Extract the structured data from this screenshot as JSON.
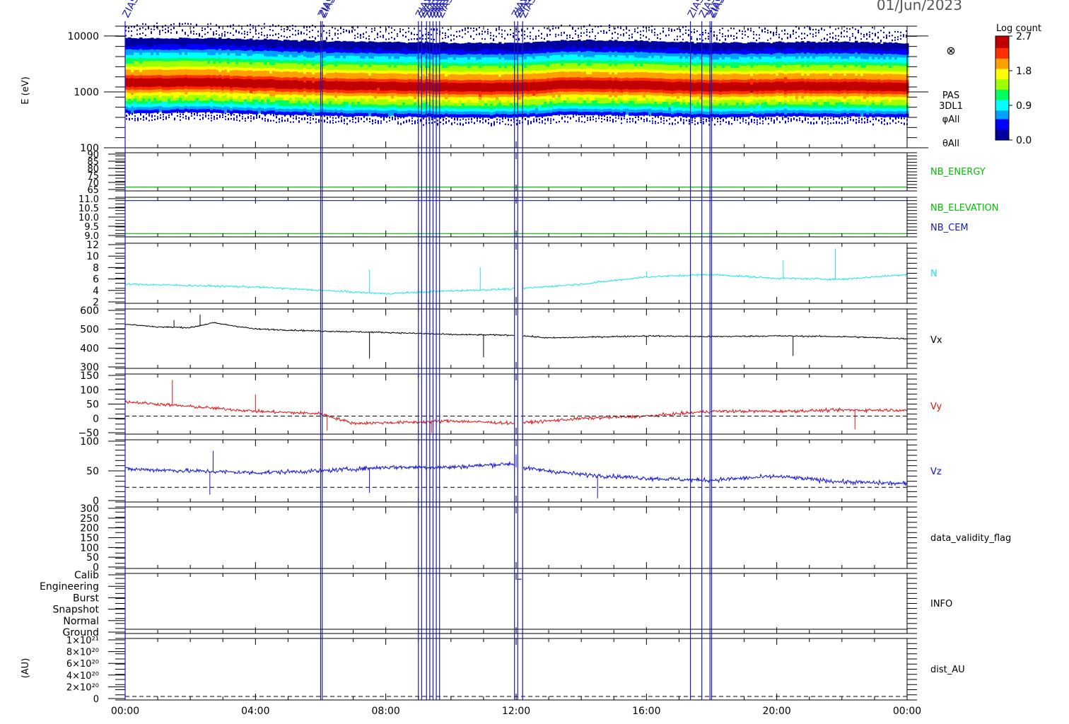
{
  "header": {
    "date": "01/Jun/2023",
    "event_label": "ZIAS"
  },
  "x_axis": {
    "tick_labels": [
      "00:00",
      "04:00",
      "08:00",
      "12:00",
      "16:00",
      "20:00",
      "00:00"
    ],
    "range_hours": [
      0,
      24
    ]
  },
  "colorbar": {
    "title": "Log count",
    "ticks": [
      "2.7",
      "1.8",
      "0.9",
      "0.0"
    ],
    "range": [
      0.0,
      2.7
    ],
    "colors": [
      "#0000a0",
      "#0000ff",
      "#00a0ff",
      "#00ffff",
      "#00ff60",
      "#a0ff00",
      "#ffff00",
      "#ffa000",
      "#ff3000",
      "#c00000"
    ]
  },
  "panels": {
    "spectrogram": {
      "ylabel": "E (eV)",
      "yticks": [
        "10000",
        "1000",
        "100"
      ],
      "side_labels": [
        "PAS",
        "3DL1",
        "φAll",
        "θAll"
      ],
      "marker_symbol": "⊗"
    },
    "nb_energy": {
      "label": "NB_ENERGY",
      "yticks": [
        "90",
        "85",
        "80",
        "75",
        "70",
        "65"
      ]
    },
    "nb_elev": {
      "label1": "NB_ELEVATION",
      "label2": "NB_CEM",
      "yticks": [
        "11.0",
        "10.5",
        "10.0",
        "9.5",
        "9.0"
      ]
    },
    "n": {
      "label": "N",
      "yticks": [
        "12",
        "10",
        "8",
        "6",
        "4",
        "2"
      ]
    },
    "vx": {
      "label": "Vx",
      "yticks": [
        "600",
        "500",
        "400",
        "300"
      ]
    },
    "vy": {
      "label": "Vy",
      "yticks": [
        "150",
        "100",
        "50",
        "0",
        "−50"
      ]
    },
    "vz": {
      "label": "Vz",
      "yticks": [
        "100",
        "50",
        "0"
      ]
    },
    "dvf": {
      "label": "data_validity_flag",
      "yticks": [
        "300",
        "250",
        "200",
        "150",
        "100",
        "50",
        "0"
      ]
    },
    "info": {
      "label": "INFO",
      "yticks": [
        "Calib",
        "Engineering",
        "Burst",
        "Snapshot",
        "Normal",
        "Ground"
      ]
    },
    "dist": {
      "label": "dist_AU",
      "ylabel": "(AU)",
      "yticks": [
        "1×10²¹",
        "8×10²⁰",
        "6×10²⁰",
        "4×10²⁰",
        "2×10²⁰",
        "0"
      ]
    }
  },
  "colors": {
    "green": "#00c000",
    "navy": "#1a1ab4",
    "cyan": "#22e6ee",
    "black": "#000000",
    "red": "#e61010",
    "blue": "#1010e0",
    "event_line": "#1a1ab4"
  },
  "chart_data": {
    "type": "line",
    "x_unit": "hours since 2023-06-01 00:00",
    "event_times_h": [
      0.0,
      6.0,
      6.05,
      9.0,
      9.1,
      9.25,
      9.35,
      9.45,
      9.55,
      9.65,
      11.95,
      12.05,
      12.2,
      17.35,
      17.7,
      17.95,
      18.0
    ],
    "spectrogram": {
      "type": "heatmap",
      "y_scale": "log",
      "ylim": [
        100,
        15000
      ],
      "peak_energy_eV": [
        [
          0,
          1500
        ],
        [
          2,
          1550
        ],
        [
          4,
          1450
        ],
        [
          6,
          1350
        ],
        [
          8,
          1300
        ],
        [
          10,
          1250
        ],
        [
          12,
          1250
        ],
        [
          13.5,
          1400
        ],
        [
          16,
          1350
        ],
        [
          18,
          1250
        ],
        [
          20,
          1300
        ],
        [
          22,
          1300
        ],
        [
          24,
          1250
        ]
      ]
    },
    "nb_energy": {
      "value": 65,
      "ylim": [
        62,
        92
      ]
    },
    "nb_elevation": {
      "value": 11.0,
      "ylim": [
        8.8,
        11.2
      ]
    },
    "nb_cem": {
      "value": 9.0
    },
    "density": {
      "ylim": [
        1,
        13.5
      ],
      "points": [
        [
          0,
          5.0
        ],
        [
          2,
          4.7
        ],
        [
          4,
          4.4
        ],
        [
          6,
          3.7
        ],
        [
          8,
          3.0
        ],
        [
          10,
          3.6
        ],
        [
          12,
          4.0
        ],
        [
          14,
          5.0
        ],
        [
          16,
          6.5
        ],
        [
          18,
          7.0
        ],
        [
          20,
          6.2
        ],
        [
          22,
          6.0
        ],
        [
          24,
          7.0
        ]
      ],
      "spikes": [
        [
          7.5,
          8
        ],
        [
          10.9,
          8.5
        ],
        [
          16.0,
          7.7
        ],
        [
          20.2,
          10
        ],
        [
          21.8,
          12.4
        ],
        [
          24,
          10.5
        ]
      ]
    },
    "vx": {
      "ylim": [
        250,
        680
      ],
      "points": [
        [
          0,
          570
        ],
        [
          1,
          550
        ],
        [
          2,
          545
        ],
        [
          2.7,
          580
        ],
        [
          4,
          535
        ],
        [
          6,
          520
        ],
        [
          8,
          510
        ],
        [
          10,
          495
        ],
        [
          12,
          490
        ],
        [
          13,
          470
        ],
        [
          14,
          475
        ],
        [
          16,
          485
        ],
        [
          18,
          480
        ],
        [
          20,
          485
        ],
        [
          22,
          480
        ],
        [
          24,
          465
        ]
      ],
      "spikes": [
        [
          1.5,
          600
        ],
        [
          2.3,
          640
        ],
        [
          7.5,
          320
        ],
        [
          11.0,
          330
        ],
        [
          16.0,
          420
        ],
        [
          20.5,
          340
        ]
      ]
    },
    "vy": {
      "ylim": [
        -75,
        175
      ],
      "points": [
        [
          0,
          60
        ],
        [
          1,
          50
        ],
        [
          2,
          40
        ],
        [
          4,
          20
        ],
        [
          6,
          10
        ],
        [
          7,
          -30
        ],
        [
          9,
          -25
        ],
        [
          10,
          -20
        ],
        [
          12,
          -30
        ],
        [
          14,
          -10
        ],
        [
          16,
          0
        ],
        [
          18,
          20
        ],
        [
          20,
          20
        ],
        [
          22,
          25
        ],
        [
          24,
          25
        ]
      ],
      "spikes": [
        [
          1.45,
          150
        ],
        [
          4.0,
          90
        ],
        [
          6.2,
          -60
        ],
        [
          9.4,
          -70
        ],
        [
          22.4,
          -55
        ]
      ]
    },
    "vz": {
      "ylim": [
        -40,
        130
      ],
      "points": [
        [
          0,
          50
        ],
        [
          2,
          45
        ],
        [
          4,
          40
        ],
        [
          6,
          45
        ],
        [
          8,
          55
        ],
        [
          10,
          55
        ],
        [
          11.9,
          65
        ],
        [
          12,
          55
        ],
        [
          14,
          35
        ],
        [
          16,
          25
        ],
        [
          17.5,
          20
        ],
        [
          18,
          20
        ],
        [
          20,
          30
        ],
        [
          22,
          15
        ],
        [
          24,
          10
        ]
      ],
      "spikes": [
        [
          2.7,
          100
        ],
        [
          2.6,
          -20
        ],
        [
          7.5,
          -15
        ],
        [
          14.5,
          -30
        ],
        [
          12,
          90
        ]
      ]
    },
    "data_validity_flag": {
      "ylim": [
        0,
        300
      ],
      "values": []
    },
    "info": {
      "levels": [
        "Calib",
        "Engineering",
        "Burst",
        "Snapshot",
        "Normal",
        "Ground"
      ],
      "marker": [
        [
          12.1,
          "Engineering"
        ]
      ]
    },
    "dist_AU": {
      "ylim": [
        0,
        1e+21
      ],
      "values": [
        [
          0,
          0
        ],
        [
          24,
          0
        ]
      ]
    }
  }
}
